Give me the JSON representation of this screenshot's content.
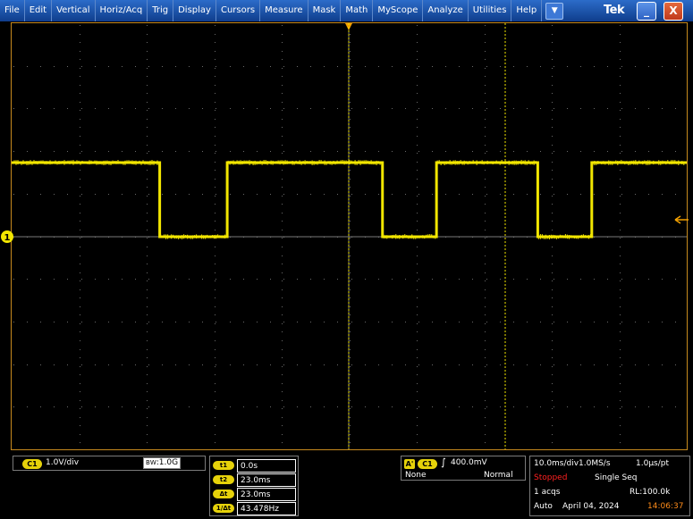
{
  "menu": [
    "File",
    "Edit",
    "Vertical",
    "Horiz/Acq",
    "Trig",
    "Display",
    "Cursors",
    "Measure",
    "Mask",
    "Math",
    "MyScope",
    "Analyze",
    "Utilities",
    "Help"
  ],
  "menu_dropdown": "▼",
  "brand": "Tek",
  "window": {
    "minimize": "_",
    "close": "X"
  },
  "channel1": {
    "label": "C1",
    "scale": "1.0V/div",
    "bw": "1.0G",
    "bw_prefix": "B",
    "bw_sub": "W",
    "marker": "1"
  },
  "cursors": [
    {
      "label": "t1",
      "value": "0.0s"
    },
    {
      "label": "t2",
      "value": "23.0ms"
    },
    {
      "label": "Δt",
      "value": "23.0ms"
    },
    {
      "label": "1/Δt",
      "value": "43.478Hz"
    }
  ],
  "trigger": {
    "source_tag": "A'",
    "channel": "C1",
    "slope": "∫",
    "level": "400.0mV",
    "coupling": "None",
    "mode": "Normal"
  },
  "acquisition": {
    "timebase": "10.0ms/div",
    "sample_rate": "1.0MS/s",
    "resolution": "1.0μs/pt",
    "state": "Stopped",
    "run_mode": "Single Seq",
    "acqs": "1 acqs",
    "record_length": "RL:100.0k",
    "trigger_mode": "Auto",
    "date": "April 04, 2024",
    "time": "14:06:37"
  },
  "colors": {
    "trace": "#f2e600",
    "grid_border": "#c78a1e",
    "stopped": "#ff2020",
    "time": "#ff8c1a"
  },
  "waveform": {
    "high_level_div": -1.1,
    "low_level_div": 0.0,
    "edges_ms": [
      -28.0,
      -18.0,
      5.0,
      13.0,
      28.0,
      36.0
    ],
    "start_high": true
  }
}
